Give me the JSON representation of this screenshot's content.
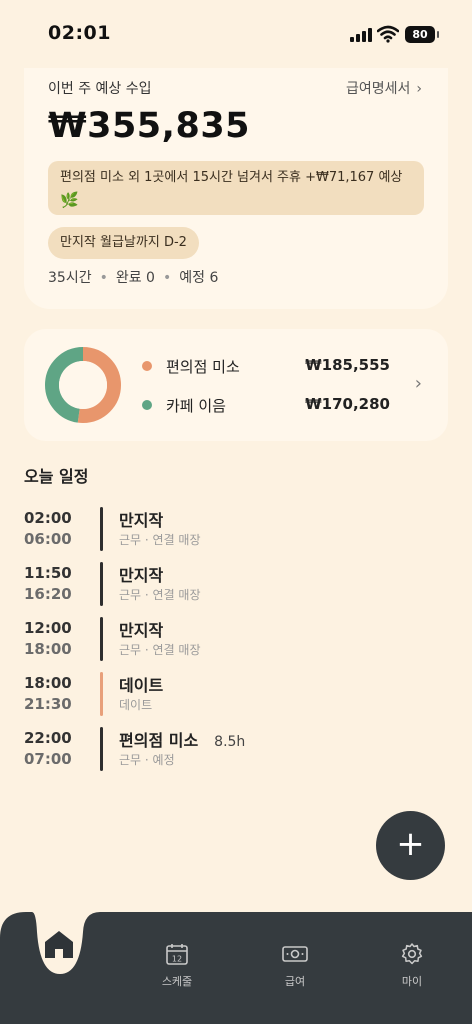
{
  "status_bar": {
    "time": "02:01",
    "battery": "80"
  },
  "summary": {
    "week_label": "이번 주 예상 수입",
    "payslip_link": "급여명세서",
    "amount": "₩355,835",
    "note": "편의점 미소 외 1곳에서 15시간 넘겨서 주휴 +₩71,167 예상",
    "dday": "만지작 월급날까지 D-2",
    "stats": {
      "hours": "35시간",
      "done": "완료 0",
      "planned": "예정 6"
    }
  },
  "breakdown": {
    "items": [
      {
        "name": "편의점 미소",
        "amount": "₩185,555",
        "color": "#E8966C",
        "value": 185555
      },
      {
        "name": "카페 이음",
        "amount": "₩170,280",
        "color": "#5FA585",
        "value": 170280
      }
    ]
  },
  "schedule": {
    "title": "오늘 일정",
    "items": [
      {
        "start": "02:00",
        "end": "06:00",
        "title": "만지작",
        "hours": "",
        "sub": "근무 · 연결 매장",
        "color": "dark"
      },
      {
        "start": "11:50",
        "end": "16:20",
        "title": "만지작",
        "hours": "",
        "sub": "근무 · 연결 매장",
        "color": "dark"
      },
      {
        "start": "12:00",
        "end": "18:00",
        "title": "만지작",
        "hours": "",
        "sub": "근무 · 연결 매장",
        "color": "dark"
      },
      {
        "start": "18:00",
        "end": "21:30",
        "title": "데이트",
        "hours": "",
        "sub": "데이트",
        "color": "orange"
      },
      {
        "start": "22:00",
        "end": "07:00",
        "title": "편의점 미소",
        "hours": "8.5h",
        "sub": "근무 · 예정",
        "color": "dark"
      }
    ]
  },
  "fab": {
    "label": "+"
  },
  "tabs": [
    {
      "id": "home",
      "label": "",
      "icon": "home-icon",
      "active": true
    },
    {
      "id": "schedule",
      "label": "스케줄",
      "icon": "calendar-icon",
      "calendar_day": "12"
    },
    {
      "id": "pay",
      "label": "급여",
      "icon": "money-icon"
    },
    {
      "id": "my",
      "label": "마이",
      "icon": "gear-icon"
    }
  ],
  "colors": {
    "background": "#FDF2E1",
    "card": "#FFF7EB",
    "accent_orange": "#E8966C",
    "accent_green": "#5FA585",
    "tabbar": "#353B3F"
  }
}
